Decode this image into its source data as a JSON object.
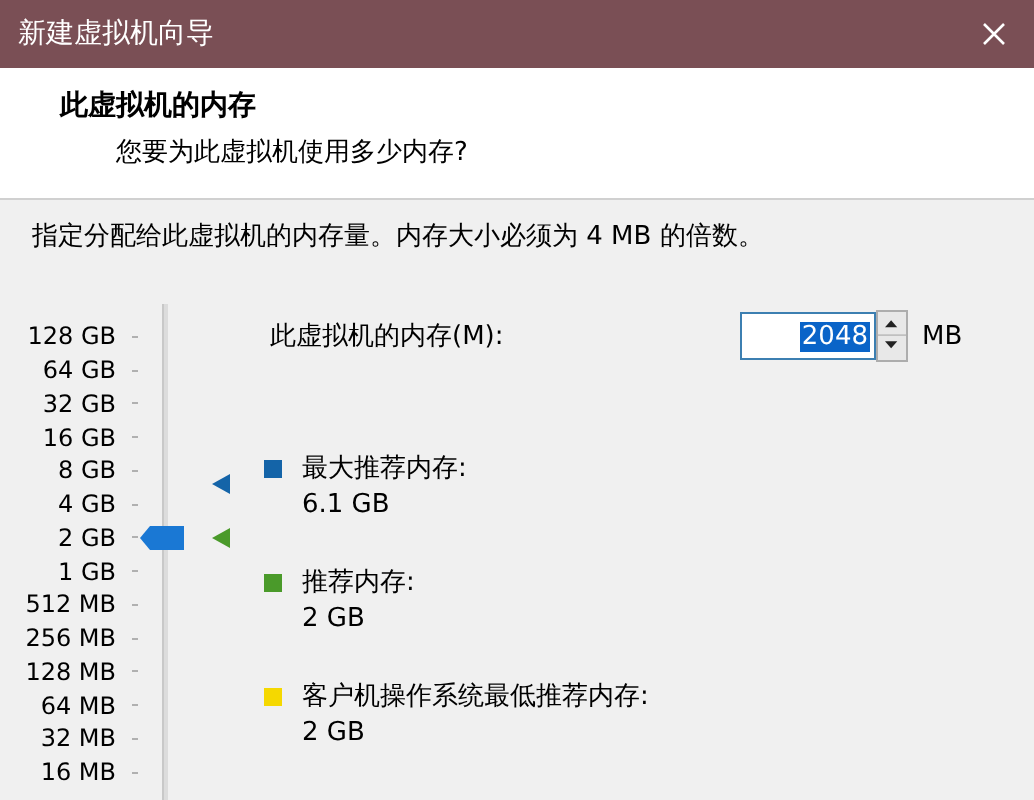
{
  "window": {
    "title": "新建虚拟机向导"
  },
  "header": {
    "title": "此虚拟机的内存",
    "subtitle": "您要为此虚拟机使用多少内存?"
  },
  "instruction": "指定分配给此虚拟机的内存量。内存大小必须为 4 MB 的倍数。",
  "slider": {
    "ticks": [
      "128 GB",
      "64 GB",
      "32 GB",
      "16 GB",
      "8 GB",
      "4 GB",
      "2 GB",
      "1 GB",
      "512 MB",
      "256 MB",
      "128 MB",
      "64 MB",
      "32 MB",
      "16 MB"
    ],
    "level": 0.538,
    "markers": [
      {
        "color": "#1464a8",
        "level": 0.662
      },
      {
        "color": "#4a9a2a",
        "level": 0.538
      }
    ]
  },
  "memory_field": {
    "label": "此虚拟机的内存(M):",
    "value": "2048",
    "unit": "MB"
  },
  "recommendations": [
    {
      "color": "#1464a8",
      "label": "最大推荐内存:",
      "value": "6.1 GB"
    },
    {
      "color": "#4a9a2a",
      "label": "推荐内存:",
      "value": "2 GB"
    },
    {
      "color": "#f5d800",
      "label": "客户机操作系统最低推荐内存:",
      "value": "2 GB"
    }
  ]
}
